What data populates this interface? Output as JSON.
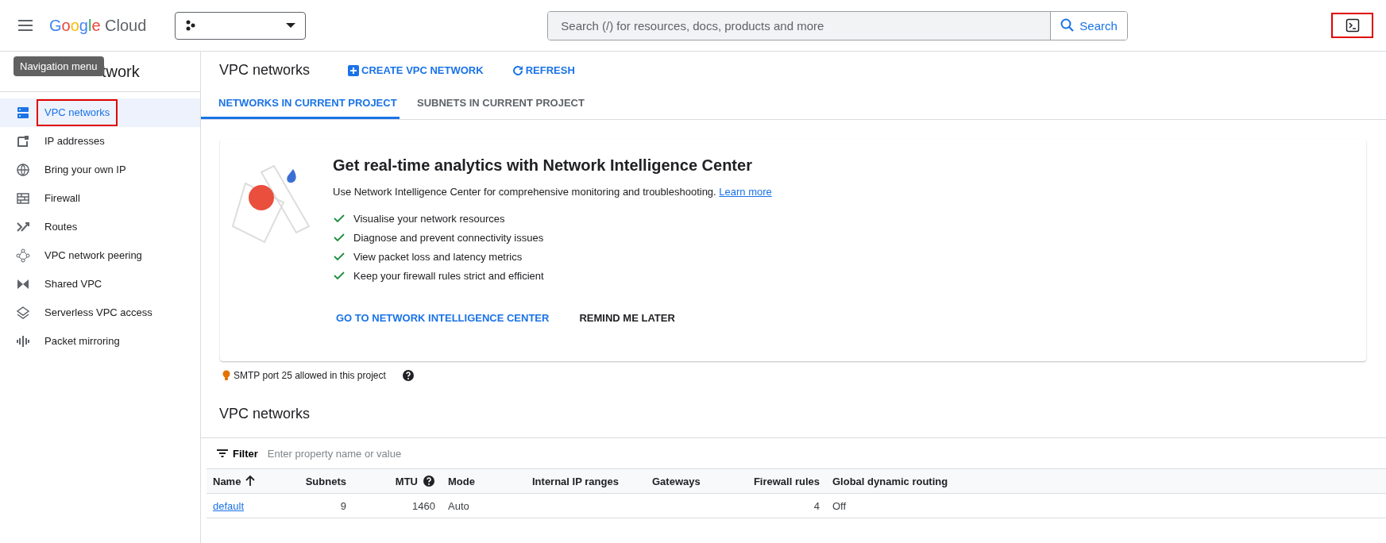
{
  "top_bar": {
    "logo": {
      "first": "Google",
      "second": "Cloud"
    },
    "search": {
      "placeholder": "Search (/) for resources, docs, products and more",
      "button": "Search"
    },
    "terminal_button": {
      "highlighted": true
    }
  },
  "tooltip": "Navigation menu",
  "sidebar": {
    "title": "twork",
    "items": [
      {
        "label": "VPC networks",
        "selected": true,
        "highlighted": true
      },
      {
        "label": "IP addresses",
        "selected": false,
        "highlighted": false
      },
      {
        "label": "Bring your own IP",
        "selected": false,
        "highlighted": false
      },
      {
        "label": "Firewall",
        "selected": false,
        "highlighted": false
      },
      {
        "label": "Routes",
        "selected": false,
        "highlighted": false
      },
      {
        "label": "VPC network peering",
        "selected": false,
        "highlighted": false
      },
      {
        "label": "Shared VPC",
        "selected": false,
        "highlighted": false
      },
      {
        "label": "Serverless VPC access",
        "selected": false,
        "highlighted": false
      },
      {
        "label": "Packet mirroring",
        "selected": false,
        "highlighted": false
      }
    ]
  },
  "page": {
    "title": "VPC networks",
    "actions": [
      {
        "label": "CREATE VPC NETWORK",
        "kind": "create"
      },
      {
        "label": "REFRESH",
        "kind": "refresh"
      }
    ]
  },
  "tabs": [
    {
      "label": "NETWORKS IN CURRENT PROJECT",
      "selected": true
    },
    {
      "label": "SUBNETS IN CURRENT PROJECT",
      "selected": false
    }
  ],
  "banner": {
    "title": "Get real-time analytics with Network Intelligence Center",
    "description": "Use Network Intelligence Center for comprehensive monitoring and troubleshooting.",
    "link": "Learn more",
    "features": [
      "Visualise your network resources",
      "Diagnose and prevent connectivity issues",
      "View packet loss and latency metrics",
      "Keep your firewall rules strict and efficient"
    ],
    "buttons": [
      {
        "label": "GO TO NETWORK INTELLIGENCE CENTER",
        "kind": "primary"
      },
      {
        "label": "REMIND ME LATER",
        "kind": "secondary"
      }
    ]
  },
  "notice": {
    "text": "SMTP port 25 allowed in this project"
  },
  "table_section": {
    "title": "VPC networks",
    "filter": {
      "label": "Filter",
      "placeholder": "Enter property name or value"
    },
    "columns": [
      {
        "label": "Name",
        "sorted_ascending": true,
        "help": false
      },
      {
        "label": "Subnets",
        "sorted_ascending": false,
        "help": false
      },
      {
        "label": "MTU",
        "sorted_ascending": false,
        "help": true
      },
      {
        "label": "Mode",
        "sorted_ascending": false,
        "help": false
      },
      {
        "label": "Internal IP ranges",
        "sorted_ascending": false,
        "help": false
      },
      {
        "label": "Gateways",
        "sorted_ascending": false,
        "help": false
      },
      {
        "label": "Firewall rules",
        "sorted_ascending": false,
        "help": false
      },
      {
        "label": "Global dynamic routing",
        "sorted_ascending": false,
        "help": false
      }
    ],
    "rows": [
      {
        "name": "default",
        "subnets": "9",
        "mtu": "1460",
        "mode": "Auto",
        "firewall_rules": "4",
        "global_dynamic_routing": "Off"
      }
    ]
  }
}
